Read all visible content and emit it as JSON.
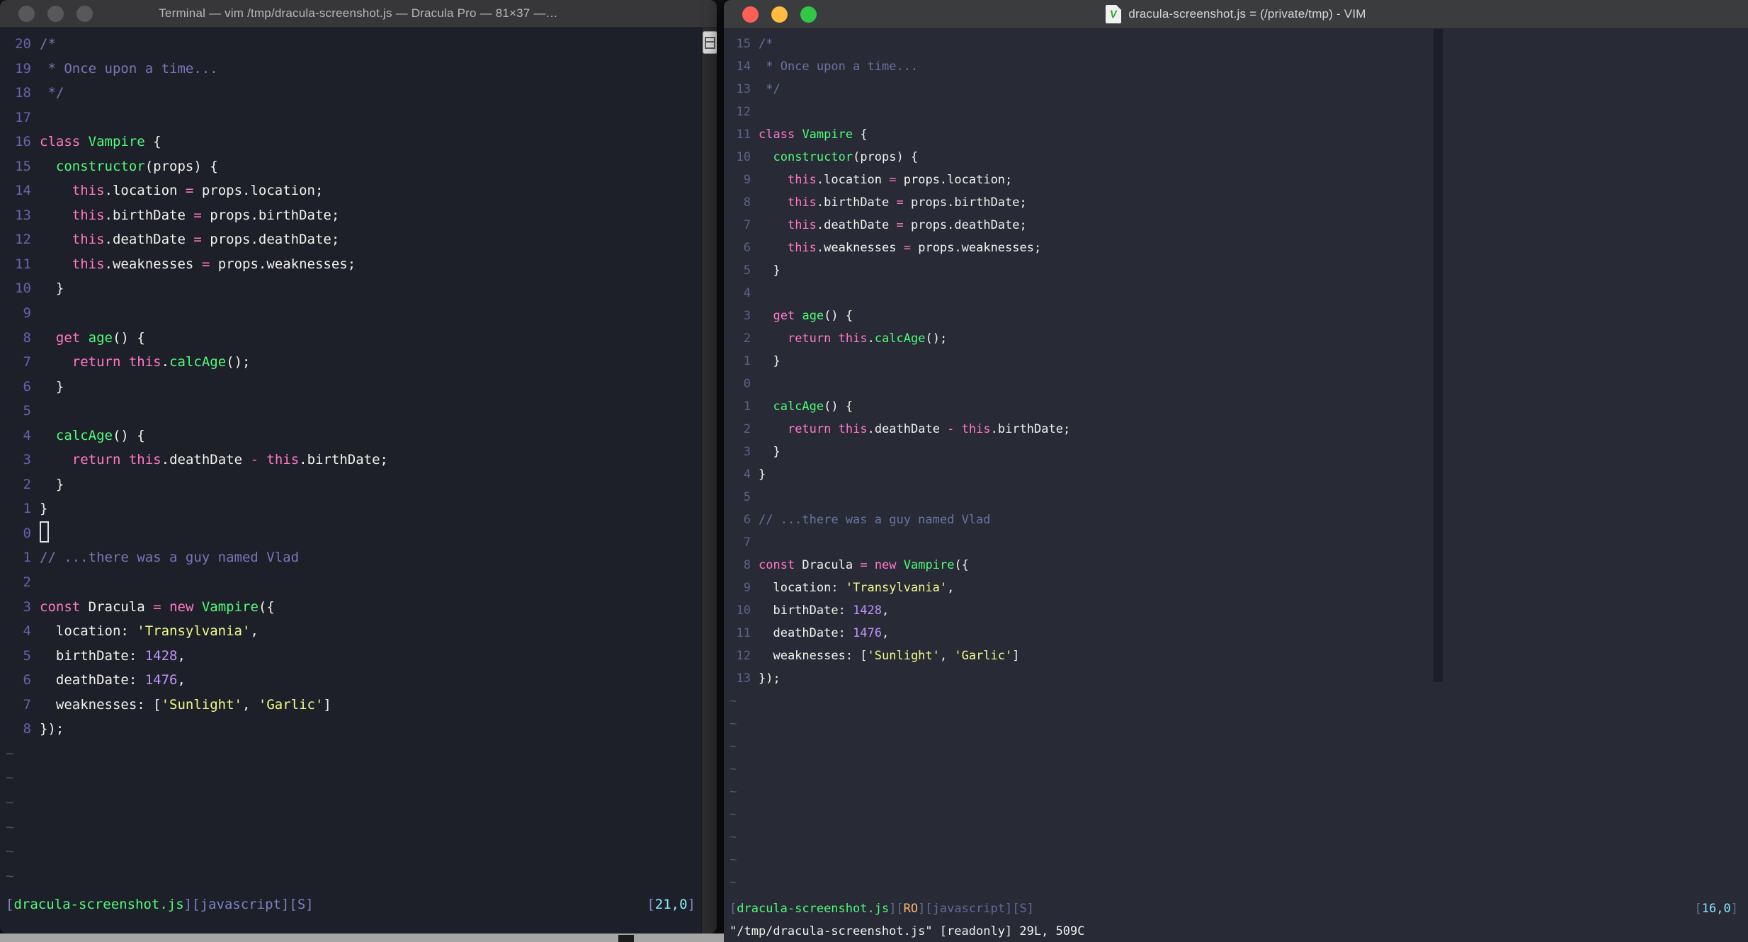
{
  "palette": {
    "left_bg": "#1e2029",
    "right_bg": "#282a36",
    "foreground": "#f2f2ec",
    "pink": "#ff79c6",
    "green": "#50fa7b",
    "yellow": "#f1fa8c",
    "purple": "#bd93f9",
    "cyan": "#8be9fd",
    "orange": "#ffb86c",
    "comment_left": "#7c74b8",
    "comment_right": "#66759f",
    "traffic_red": "#fc5f57",
    "traffic_yellow": "#febc40",
    "traffic_green": "#33c748",
    "traffic_inactive": "#58585b"
  },
  "code_lines": [
    [
      [
        "c",
        "/*"
      ]
    ],
    [
      [
        "c",
        " * Once upon a time..."
      ]
    ],
    [
      [
        "c",
        " */"
      ]
    ],
    [],
    [
      [
        "k",
        "class"
      ],
      [
        "t",
        " "
      ],
      [
        "f",
        "Vampire"
      ],
      [
        "t",
        " {"
      ]
    ],
    [
      [
        "t",
        "  "
      ],
      [
        "f",
        "constructor"
      ],
      [
        "t",
        "(props) {"
      ]
    ],
    [
      [
        "t",
        "    "
      ],
      [
        "k",
        "this"
      ],
      [
        "t",
        ".location "
      ],
      [
        "k",
        "="
      ],
      [
        "t",
        " props.location;"
      ]
    ],
    [
      [
        "t",
        "    "
      ],
      [
        "k",
        "this"
      ],
      [
        "t",
        ".birthDate "
      ],
      [
        "k",
        "="
      ],
      [
        "t",
        " props.birthDate;"
      ]
    ],
    [
      [
        "t",
        "    "
      ],
      [
        "k",
        "this"
      ],
      [
        "t",
        ".deathDate "
      ],
      [
        "k",
        "="
      ],
      [
        "t",
        " props.deathDate;"
      ]
    ],
    [
      [
        "t",
        "    "
      ],
      [
        "k",
        "this"
      ],
      [
        "t",
        ".weaknesses "
      ],
      [
        "k",
        "="
      ],
      [
        "t",
        " props.weaknesses;"
      ]
    ],
    [
      [
        "t",
        "  }"
      ]
    ],
    [],
    [
      [
        "t",
        "  "
      ],
      [
        "k",
        "get"
      ],
      [
        "t",
        " "
      ],
      [
        "f",
        "age"
      ],
      [
        "t",
        "() {"
      ]
    ],
    [
      [
        "t",
        "    "
      ],
      [
        "k",
        "return"
      ],
      [
        "t",
        " "
      ],
      [
        "k",
        "this"
      ],
      [
        "t",
        "."
      ],
      [
        "f",
        "calcAge"
      ],
      [
        "t",
        "();"
      ]
    ],
    [
      [
        "t",
        "  }"
      ]
    ],
    [],
    [
      [
        "t",
        "  "
      ],
      [
        "f",
        "calcAge"
      ],
      [
        "t",
        "() {"
      ]
    ],
    [
      [
        "t",
        "    "
      ],
      [
        "k",
        "return"
      ],
      [
        "t",
        " "
      ],
      [
        "k",
        "this"
      ],
      [
        "t",
        ".deathDate "
      ],
      [
        "k",
        "-"
      ],
      [
        "t",
        " "
      ],
      [
        "k",
        "this"
      ],
      [
        "t",
        ".birthDate;"
      ]
    ],
    [
      [
        "t",
        "  }"
      ]
    ],
    [
      [
        "t",
        "}"
      ]
    ],
    [],
    [
      [
        "c",
        "// ...there was a guy named Vlad"
      ]
    ],
    [],
    [
      [
        "k",
        "const"
      ],
      [
        "t",
        " Dracula "
      ],
      [
        "k",
        "="
      ],
      [
        "t",
        " "
      ],
      [
        "k",
        "new"
      ],
      [
        "t",
        " "
      ],
      [
        "f",
        "Vampire"
      ],
      [
        "t",
        "({"
      ]
    ],
    [
      [
        "t",
        "  location: "
      ],
      [
        "s",
        "'Transylvania'"
      ],
      [
        "t",
        ","
      ]
    ],
    [
      [
        "t",
        "  birthDate: "
      ],
      [
        "n",
        "1428"
      ],
      [
        "t",
        ","
      ]
    ],
    [
      [
        "t",
        "  deathDate: "
      ],
      [
        "n",
        "1476"
      ],
      [
        "t",
        ","
      ]
    ],
    [
      [
        "t",
        "  weaknesses: ["
      ],
      [
        "s",
        "'Sunlight'"
      ],
      [
        "t",
        ", "
      ],
      [
        "s",
        "'Garlic'"
      ],
      [
        "t",
        "]"
      ]
    ],
    [
      [
        "t",
        "});"
      ]
    ]
  ],
  "left_window": {
    "title": "Terminal — vim /tmp/dracula-screenshot.js — Dracula Pro — 81×37 —…",
    "numbers": [
      "20",
      "19",
      "18",
      "17",
      "16",
      "15",
      "14",
      "13",
      "12",
      "11",
      "10",
      "9",
      "8",
      "7",
      "6",
      "5",
      "4",
      "3",
      "2",
      "1",
      "0",
      "1",
      "2",
      "3",
      "4",
      "5",
      "6",
      "7",
      "8"
    ],
    "cursor_index": 20,
    "tilde_count": 6,
    "status_left": [
      [
        "b",
        "["
      ],
      [
        "g",
        "dracula-screenshot.js"
      ],
      [
        "b",
        "]["
      ],
      [
        "b",
        "javascript"
      ],
      [
        "b",
        "]["
      ],
      [
        "b",
        "S"
      ],
      [
        "b",
        "]"
      ]
    ],
    "status_right": [
      [
        "b",
        "["
      ],
      [
        "y",
        "21,0"
      ],
      [
        "b",
        "]"
      ]
    ],
    "cmdline": ""
  },
  "right_window": {
    "title": "dracula-screenshot.js = (/private/tmp) - VIM",
    "doc_icon_letter": "V",
    "numbers": [
      "15",
      "14",
      "13",
      "12",
      "11",
      "10",
      "9",
      "8",
      "7",
      "6",
      "5",
      "4",
      "3",
      "2",
      "1",
      "0",
      "1",
      "2",
      "3",
      "4",
      "5",
      "6",
      "7",
      "8",
      "9",
      "10",
      "11",
      "12",
      "13"
    ],
    "cursor_index": -1,
    "tilde_count": 9,
    "status_left": [
      [
        "b",
        "["
      ],
      [
        "g",
        "dracula-screenshot.js"
      ],
      [
        "b",
        "]["
      ],
      [
        "o",
        "RO"
      ],
      [
        "b",
        "]["
      ],
      [
        "b",
        "javascript"
      ],
      [
        "b",
        "]["
      ],
      [
        "b",
        "S"
      ],
      [
        "b",
        "]"
      ]
    ],
    "status_right": [
      [
        "b",
        "["
      ],
      [
        "y",
        "16,0"
      ],
      [
        "b",
        "]"
      ]
    ],
    "cmdline": "\"/tmp/dracula-screenshot.js\" [readonly] 29L, 509C"
  }
}
